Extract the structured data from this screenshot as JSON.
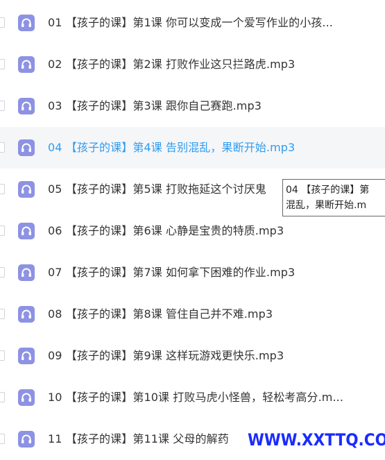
{
  "colors": {
    "icon_bg": "#8d92e3",
    "hover_text": "#2f9cf0",
    "hover_bg": "#f5f6f8",
    "text": "#333333"
  },
  "items": [
    {
      "label": "01 【孩子的课】第1课 你可以变成一个爱写作业的小孩...",
      "icon": "headphones-icon"
    },
    {
      "label": "02 【孩子的课】第2课 打败作业这只拦路虎.mp3",
      "icon": "headphones-icon"
    },
    {
      "label": "03 【孩子的课】第3课 跟你自己赛跑.mp3",
      "icon": "headphones-icon"
    },
    {
      "label": "04 【孩子的课】第4课 告别混乱，果断开始.mp3",
      "icon": "headphones-icon",
      "hovered": true
    },
    {
      "label": "05 【孩子的课】第5课 打败拖延这个讨厌鬼",
      "icon": "headphones-icon"
    },
    {
      "label": "06 【孩子的课】第6课 心静是宝贵的特质.mp3",
      "icon": "headphones-icon"
    },
    {
      "label": "07 【孩子的课】第7课 如何拿下困难的作业.mp3",
      "icon": "headphones-icon"
    },
    {
      "label": "08 【孩子的课】第8课 管住自己并不难.mp3",
      "icon": "headphones-icon"
    },
    {
      "label": "09 【孩子的课】第9课 这样玩游戏更快乐.mp3",
      "icon": "headphones-icon"
    },
    {
      "label": "10 【孩子的课】第10课 打败马虎小怪兽，轻松考高分.m...",
      "icon": "headphones-icon"
    },
    {
      "label": "11 【孩子的课】第11课 父母的解药",
      "icon": "headphones-icon"
    }
  ],
  "tooltip": {
    "line1": "04 【孩子的课】第",
    "line2": "混乱，果断开始.m"
  },
  "watermark": "WWW.XXTTQ.COM"
}
